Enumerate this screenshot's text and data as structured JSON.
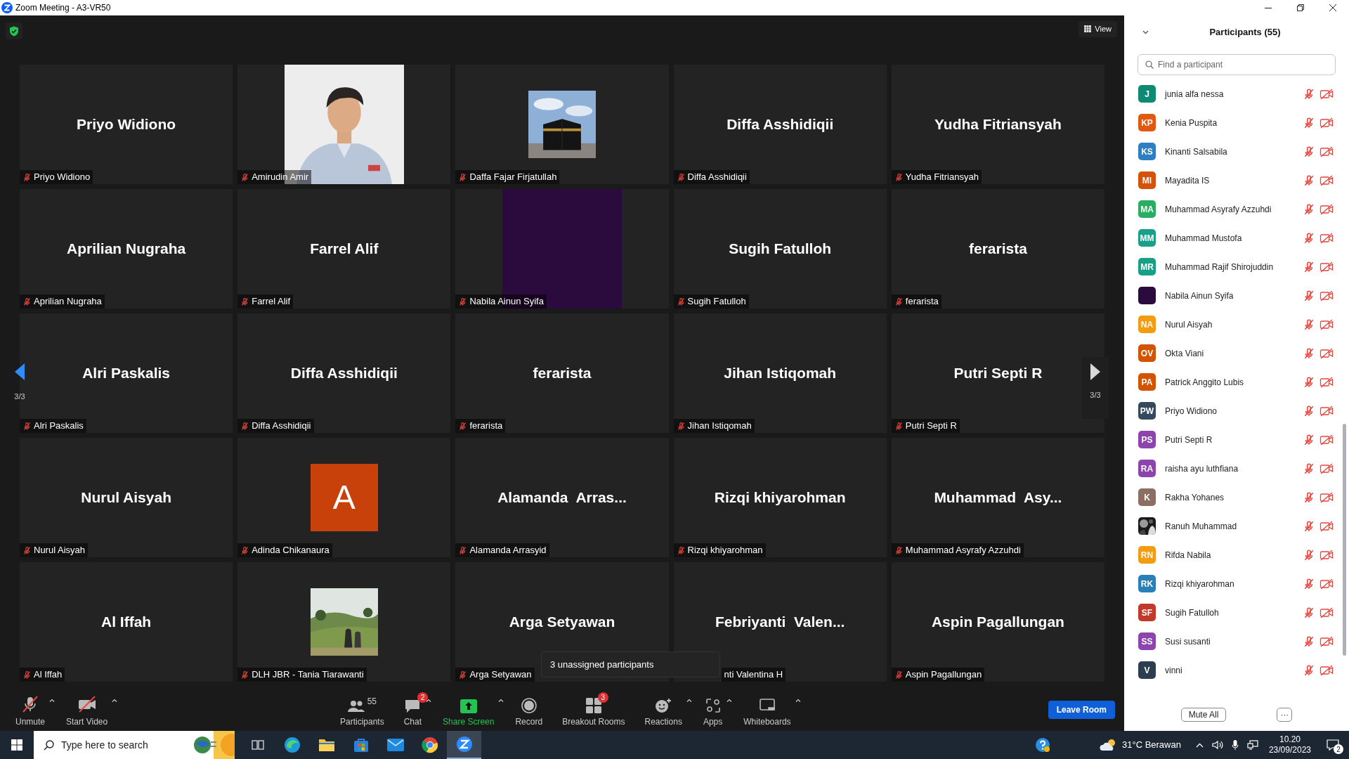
{
  "window": {
    "title": "Zoom Meeting - A3-VR50"
  },
  "top_bar": {
    "view_label": "View"
  },
  "pager": {
    "left": "3/3",
    "right": "3/3"
  },
  "tiles": [
    {
      "kind": "name",
      "display": "Priyo Widiono",
      "label": "Priyo Widiono",
      "muted": true
    },
    {
      "kind": "picture",
      "label": "Amirudin Amir",
      "muted": true
    },
    {
      "kind": "picture",
      "label": "Daffa Fajar Firjatullah",
      "muted": true
    },
    {
      "kind": "name",
      "display": "Diffa Asshidiqii",
      "label": "Diffa Asshidiqii",
      "muted": true
    },
    {
      "kind": "name",
      "display": "Yudha Fitriansyah",
      "label": "Yudha Fitriansyah",
      "muted": true
    },
    {
      "kind": "name",
      "display": "Aprilian Nugraha",
      "label": "Aprilian Nugraha",
      "muted": true
    },
    {
      "kind": "name",
      "display": "Farrel Alif",
      "label": "Farrel Alif",
      "muted": true
    },
    {
      "kind": "color",
      "color": "#2b0a3d",
      "label": "Nabila Ainun Syifa",
      "muted": true
    },
    {
      "kind": "name",
      "display": "Sugih Fatulloh",
      "label": "Sugih Fatulloh",
      "muted": true
    },
    {
      "kind": "name",
      "display": "ferarista",
      "label": "ferarista",
      "muted": true
    },
    {
      "kind": "name",
      "display": "Alri Paskalis",
      "label": "Alri Paskalis",
      "muted": true
    },
    {
      "kind": "name",
      "display": "Diffa Asshidiqii",
      "label": "Diffa Asshidiqii",
      "muted": true
    },
    {
      "kind": "name",
      "display": "ferarista",
      "label": "ferarista",
      "muted": true
    },
    {
      "kind": "name",
      "display": "Jihan Istiqomah",
      "label": "Jihan Istiqomah",
      "muted": true
    },
    {
      "kind": "name",
      "display": "Putri Septi R",
      "label": "Putri Septi R",
      "muted": true
    },
    {
      "kind": "name",
      "display": "Nurul Aisyah",
      "label": "Nurul Aisyah",
      "muted": true
    },
    {
      "kind": "letter",
      "letter": "A",
      "color": "#c8410b",
      "label": "Adinda Chikanaura",
      "muted": true
    },
    {
      "kind": "name",
      "display": "Alamanda  Arras...",
      "label": "Alamanda Arrasyid",
      "muted": true
    },
    {
      "kind": "name",
      "display": "Rizqi khiyarohman",
      "label": "Rizqi khiyarohman",
      "muted": true
    },
    {
      "kind": "name",
      "display": "Muhammad  Asy...",
      "label": "Muhammad Asyrafy Azzuhdi",
      "muted": true
    },
    {
      "kind": "name",
      "display": "Al Iffah",
      "label": "Al Iffah",
      "muted": true
    },
    {
      "kind": "picture",
      "label": "DLH JBR - Tania Tiarawanti",
      "muted": true
    },
    {
      "kind": "name",
      "display": "Arga Setyawan",
      "label": "Arga Setyawan",
      "muted": true
    },
    {
      "kind": "name",
      "display": "Febriyanti  Valen...",
      "label": "nti Valentina H",
      "covered": true
    },
    {
      "kind": "name",
      "display": "Aspin Pagallungan",
      "label": "Aspin Pagallungan",
      "muted": true
    }
  ],
  "tooltip": "3 unassigned participants",
  "toolbar": {
    "left": [
      {
        "label": "Unmute",
        "caret": true
      },
      {
        "label": "Start Video",
        "caret": true
      }
    ],
    "center": [
      {
        "label": "Participants",
        "count": "55",
        "caret": false
      },
      {
        "label": "Chat",
        "badge": "2",
        "caret": true
      },
      {
        "label": "Share Screen",
        "caret": true,
        "highlight": true
      },
      {
        "label": "Record",
        "caret": false
      },
      {
        "label": "Breakout Rooms",
        "badge": "3",
        "caret": false
      },
      {
        "label": "Reactions",
        "caret": true
      },
      {
        "label": "Apps",
        "caret": true
      },
      {
        "label": "Whiteboards",
        "caret": true
      }
    ],
    "leave": "Leave Room"
  },
  "panel": {
    "title": "Participants (55)",
    "search": {
      "placeholder": "Find a participant"
    },
    "participants": [
      {
        "initials": "J",
        "color": "#0e8a74",
        "name": "junia alfa nessa",
        "muted": true,
        "video_off": true
      },
      {
        "initials": "KP",
        "color": "#df5a10",
        "name": "Kenia Puspita",
        "muted": true,
        "video_off": true
      },
      {
        "initials": "KS",
        "color": "#2d7fc1",
        "name": "Kinanti Salsabila",
        "muted": true,
        "video_off": true
      },
      {
        "initials": "MI",
        "color": "#d4520c",
        "name": "Mayadita IS",
        "muted": true,
        "video_off": true
      },
      {
        "initials": "MA",
        "color": "#27ae60",
        "name": "Muhammad Asyrafy Azzuhdi",
        "muted": true,
        "video_off": true
      },
      {
        "initials": "MM",
        "color": "#1aa08a",
        "name": "Muhammad Mustofa",
        "muted": true,
        "video_off": true
      },
      {
        "initials": "MR",
        "color": "#17a086",
        "name": "Muhammad Rajif Shirojuddin",
        "muted": true,
        "video_off": true
      },
      {
        "color": "#2b0a3d",
        "name": "Nabila Ainun Syifa",
        "muted": true,
        "video_off": true
      },
      {
        "initials": "NA",
        "color": "#f39c12",
        "name": "Nurul Aisyah",
        "muted": true,
        "video_off": true
      },
      {
        "initials": "OV",
        "color": "#d35400",
        "name": "Okta Viani",
        "muted": true,
        "video_off": true
      },
      {
        "initials": "PA",
        "color": "#d35400",
        "name": "Patrick Anggito Lubis",
        "muted": true,
        "video_off": true
      },
      {
        "initials": "PW",
        "color": "#34495e",
        "name": "Priyo Widiono",
        "muted": true,
        "video_off": true
      },
      {
        "initials": "PS",
        "color": "#8e44ad",
        "name": "Putri Septi R",
        "muted": true,
        "video_off": true
      },
      {
        "initials": "RA",
        "color": "#8e44ad",
        "name": "raisha ayu luthfiana",
        "muted": true,
        "video_off": true
      },
      {
        "initials": "K",
        "color": "#8d6e63",
        "name": "Rakha Yohanes",
        "muted": true,
        "video_off": true
      },
      {
        "kind": "picture",
        "name": "Ranuh Muhammad",
        "muted": true,
        "video_off": true
      },
      {
        "initials": "RN",
        "color": "#f39c12",
        "name": "Rifda Nabila",
        "muted": true,
        "video_off": true
      },
      {
        "initials": "RK",
        "color": "#2980b9",
        "name": "Rizqi khiyarohman",
        "muted": true,
        "video_off": true
      },
      {
        "initials": "SF",
        "color": "#c0392b",
        "name": "Sugih Fatulloh",
        "muted": true,
        "video_off": true
      },
      {
        "initials": "SS",
        "color": "#8e44ad",
        "name": "Susi susanti",
        "muted": true,
        "video_off": true
      },
      {
        "initials": "V",
        "color": "#2c3e50",
        "name": "vinni",
        "muted": true,
        "video_off": true
      }
    ],
    "mute_all": "Mute All",
    "more": "···"
  },
  "taskbar": {
    "search": {
      "placeholder": "Type here to search"
    },
    "weather": "31°C Berawan",
    "time": "10.20",
    "date": "23/09/2023",
    "notifications": "2"
  }
}
